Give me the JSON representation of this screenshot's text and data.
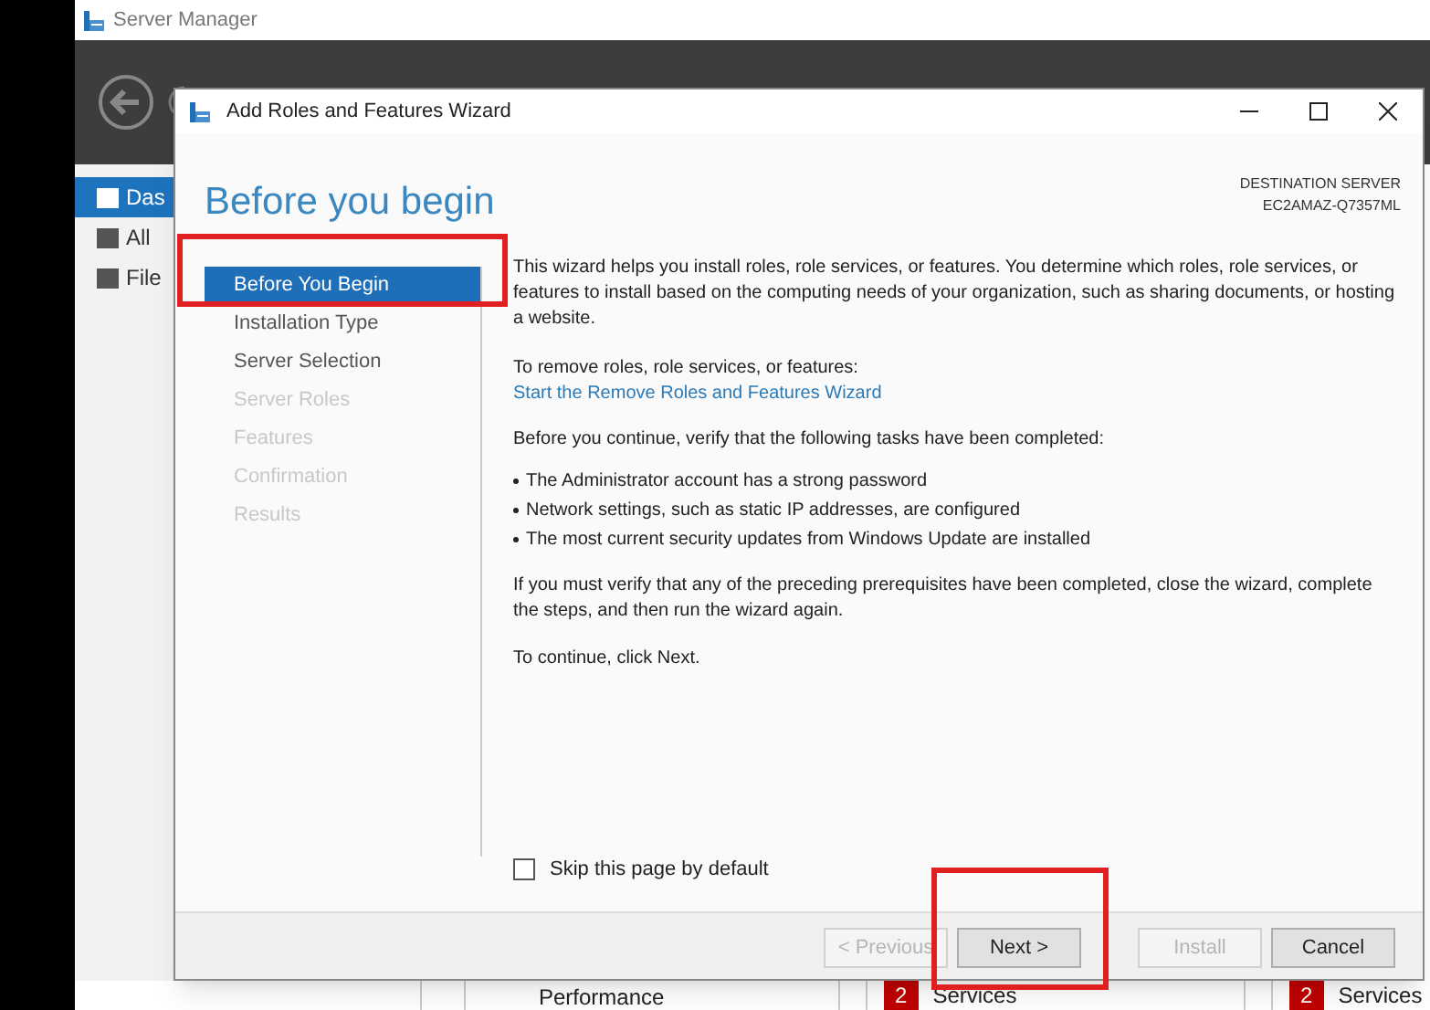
{
  "app": {
    "title": "Server Manager"
  },
  "sidebar": {
    "items": [
      {
        "label": "Das",
        "selected": true
      },
      {
        "label": "All",
        "selected": false
      },
      {
        "label": "File",
        "selected": false
      }
    ]
  },
  "tiles": [
    {
      "label": "Performance"
    },
    {
      "badge": "2",
      "label": "Services"
    },
    {
      "badge": "2",
      "label": "Services"
    }
  ],
  "wizard": {
    "title": "Add Roles and Features Wizard",
    "heading": "Before you begin",
    "destination_label": "DESTINATION SERVER",
    "destination_server": "EC2AMAZ-Q7357ML",
    "steps": [
      {
        "label": "Before You Begin",
        "selected": true,
        "disabled": false
      },
      {
        "label": "Installation Type",
        "selected": false,
        "disabled": false
      },
      {
        "label": "Server Selection",
        "selected": false,
        "disabled": false
      },
      {
        "label": "Server Roles",
        "selected": false,
        "disabled": true
      },
      {
        "label": "Features",
        "selected": false,
        "disabled": true
      },
      {
        "label": "Confirmation",
        "selected": false,
        "disabled": true
      },
      {
        "label": "Results",
        "selected": false,
        "disabled": true
      }
    ],
    "intro": "This wizard helps you install roles, role services, or features. You determine which roles, role services, or features to install based on the computing needs of your organization, such as sharing documents, or hosting a website.",
    "remove_label": "To remove roles, role services, or features:",
    "remove_link": "Start the Remove Roles and Features Wizard",
    "verify_label": "Before you continue, verify that the following tasks have been completed:",
    "tasks": [
      "The Administrator account has a strong password",
      "Network settings, such as static IP addresses, are configured",
      "The most current security updates from Windows Update are installed"
    ],
    "prereq_note": "If you must verify that any of the preceding prerequisites have been completed, close the wizard, complete the steps, and then run the wizard again.",
    "continue_note": "To continue, click Next.",
    "skip_checkbox": {
      "label": "Skip this page by default",
      "checked": false
    },
    "buttons": [
      {
        "label": "< Previous",
        "disabled": true
      },
      {
        "label": "Next >",
        "disabled": false
      },
      {
        "label": "Install",
        "disabled": true
      },
      {
        "label": "Cancel",
        "disabled": false
      }
    ]
  }
}
